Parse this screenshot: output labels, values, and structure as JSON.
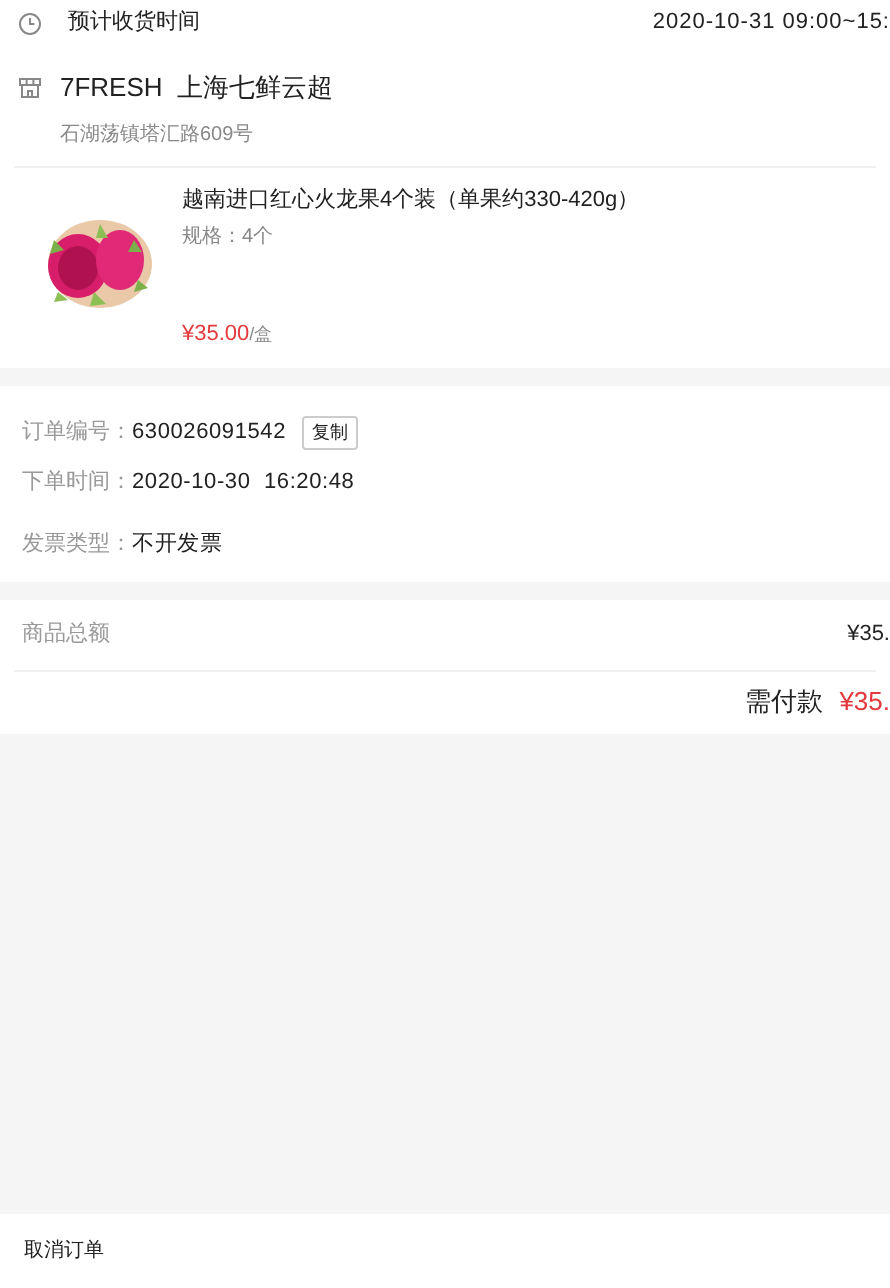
{
  "delivery": {
    "label": "预计收货时间",
    "value": "2020-10-31 09:00~15:"
  },
  "store": {
    "name": "7FRESH  上海七鲜云超",
    "address": "石湖荡镇塔汇路609号"
  },
  "product": {
    "title": "越南进口红心火龙果4个装（单果约330-420g）",
    "spec": "规格：4个",
    "price": "¥35.00",
    "unit": "/盒"
  },
  "order_info": [
    {
      "label": "订单编号：",
      "value": "630026091542",
      "action": "复制"
    },
    {
      "label": "下单时间：",
      "value": "2020-10-30  16:20:48"
    },
    {
      "label": "发票类型：",
      "value": "不开发票"
    }
  ],
  "totals": {
    "subtotal_label": "商品总额",
    "subtotal": "¥35.",
    "due_label": "需付款",
    "due": "¥35."
  },
  "bottom_bar": {
    "cancel": "取消订单"
  }
}
